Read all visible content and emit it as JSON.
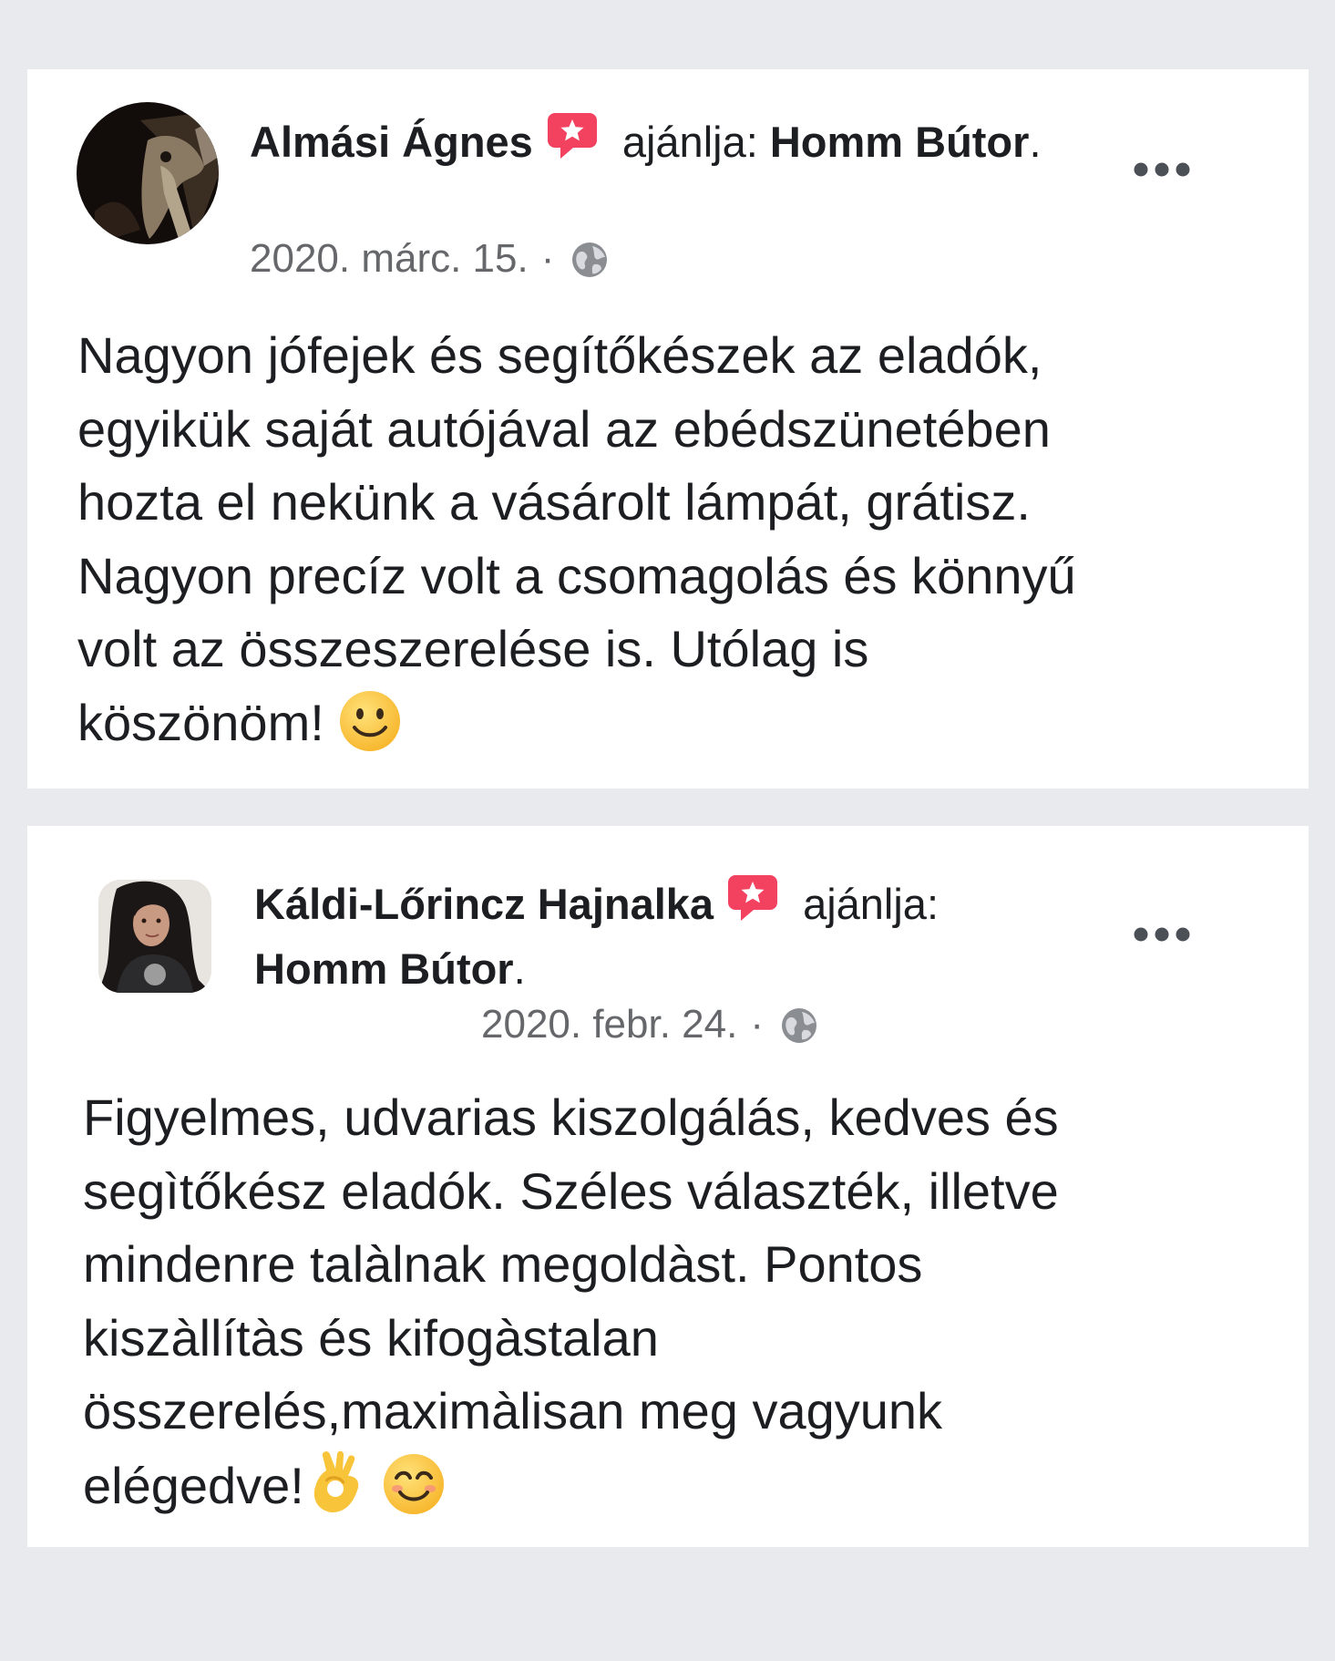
{
  "colors": {
    "background": "#e9eaee",
    "card": "#ffffff",
    "text": "#1c1e21",
    "meta_text": "#65676b",
    "recommend_badge": "#f3425f"
  },
  "reviews": [
    {
      "author": "Almási Ágnes",
      "recommend_icon": "recommend-star-badge-icon",
      "verb": "ajánlja:",
      "page": "Homm Bútor",
      "page_suffix": ".",
      "date": "2020. márc. 15.",
      "separator": "·",
      "privacy_icon": "globe-icon",
      "menu_icon": "more-options-icon",
      "text": "Nagyon jófejek és segítőkészek az eladók,\negyikük saját autójával az ebédszünetében\nhozta el nekünk a vásárolt lámpát, grátisz.\nNagyon precíz volt a csomagolás és könnyű\nvolt az összeszerelése is. Utólag is\nköszönöm!",
      "emojis": [
        "slightly-smiling-face-emoji"
      ]
    },
    {
      "author": "Káldi-Lőrincz Hajnalka",
      "recommend_icon": "recommend-star-badge-icon",
      "verb": "ajánlja:",
      "page": "Homm Bútor",
      "page_suffix": ".",
      "date": "2020. febr. 24.",
      "separator": "·",
      "privacy_icon": "globe-icon",
      "menu_icon": "more-options-icon",
      "text": "Figyelmes, udvarias kiszolgálás, kedves és\nsegìtőkész eladók. Széles választék, illetve\nmindenre talàlnak megoldàst. Pontos\nkiszàllítàs és kifogàstalan\nösszerelés,maximàlisan meg vagyunk\nelégedve!",
      "emojis": [
        "ok-hand-emoji",
        "smiling-face-with-smiling-eyes-emoji"
      ]
    }
  ]
}
